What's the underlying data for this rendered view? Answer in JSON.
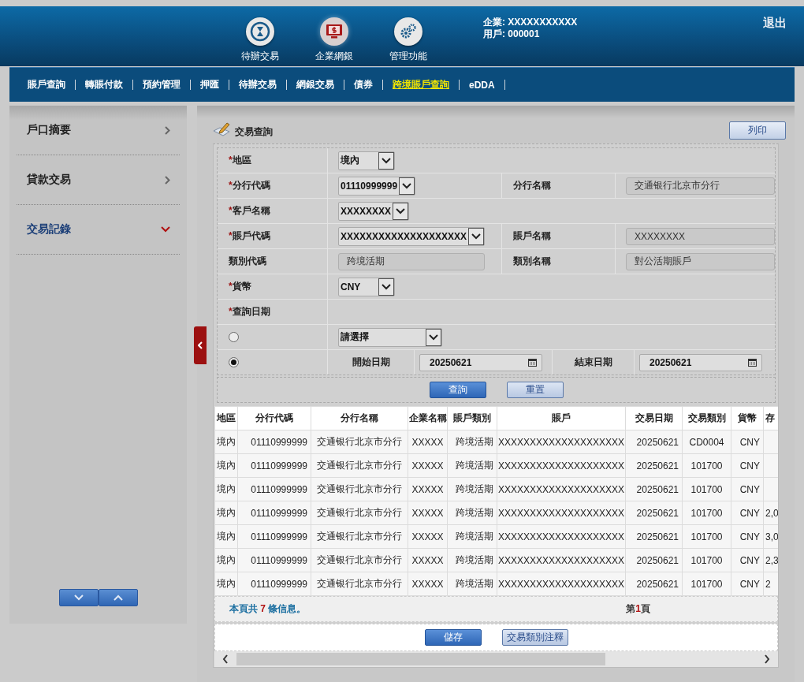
{
  "header": {
    "modules": [
      {
        "label": "待辦交易",
        "selected": false
      },
      {
        "label": "企業網銀",
        "selected": true
      },
      {
        "label": "管理功能",
        "selected": false
      }
    ],
    "company": "企業: XXXXXXXXXXX",
    "user": "用戶: 000001",
    "logout": "退出"
  },
  "nav": [
    {
      "label": "賬戶查詢",
      "selected": false
    },
    {
      "label": "轉賬付款",
      "selected": false
    },
    {
      "label": "預約管理",
      "selected": false
    },
    {
      "label": "押匯",
      "selected": false
    },
    {
      "label": "待辦交易",
      "selected": false
    },
    {
      "label": "網銀交易",
      "selected": false
    },
    {
      "label": "債券",
      "selected": false
    },
    {
      "label": "跨境賬戶查詢",
      "selected": true
    },
    {
      "label": "eDDA",
      "selected": false
    }
  ],
  "sidebar": {
    "items": [
      {
        "label": "戶口摘要",
        "expanded": false
      },
      {
        "label": "貸款交易",
        "expanded": false
      },
      {
        "label": "交易記錄",
        "expanded": true
      }
    ]
  },
  "page": {
    "title": "交易查詢",
    "print_button": "列印"
  },
  "form": {
    "rows": [
      {
        "kind": "field",
        "label": "地區",
        "required_mark": "*",
        "control": {
          "kind": "select",
          "value": "境內"
        }
      },
      {
        "kind": "field",
        "label": "分行代碼",
        "required_mark": "*",
        "control": {
          "kind": "select",
          "value": "01110999999"
        },
        "right": {
          "label": "分行名稱",
          "control": {
            "kind": "readonly",
            "value": "交通银行北京市分行"
          }
        }
      },
      {
        "kind": "field",
        "label": "客戶名稱",
        "required_mark": "*",
        "control": {
          "kind": "select",
          "value": "XXXXXXXX"
        }
      },
      {
        "kind": "field",
        "label": "賬戶代碼",
        "required_mark": "*",
        "control": {
          "kind": "select",
          "value": "XXXXXXXXXXXXXXXXXXXX"
        },
        "right": {
          "label": "賬戶名稱",
          "control": {
            "kind": "readonly",
            "value": "XXXXXXXX"
          }
        }
      },
      {
        "kind": "field",
        "label": "類別代碼",
        "control": {
          "kind": "readonly",
          "value": "跨境活期"
        },
        "right": {
          "label": "類別名稱",
          "control": {
            "kind": "readonly",
            "value": "對公活期賬戶"
          }
        }
      },
      {
        "kind": "field",
        "label": "貨幣",
        "required_mark": "*",
        "control": {
          "kind": "select",
          "value": "CNY"
        }
      },
      {
        "kind": "field",
        "label": "查詢日期",
        "required_mark": "*"
      },
      {
        "kind": "radio-select",
        "selected": false,
        "value": "請選擇"
      },
      {
        "kind": "radio-range",
        "selected": true,
        "start_label": "開始日期",
        "start": "20250621",
        "end_label": "結束日期",
        "end": "20250621"
      }
    ],
    "buttons": [
      {
        "label": "查詢",
        "primary": true
      },
      {
        "label": "重置",
        "primary": false
      }
    ]
  },
  "table": {
    "columns": [
      "地區",
      "分行代碼",
      "分行名稱",
      "企業名稱",
      "賬戶類別",
      "賬戶",
      "交易日期",
      "交易類別",
      "貨幣",
      "存"
    ],
    "rows": [
      {
        "cells": [
          "境內",
          "01110999999",
          "交通银行北京市分行",
          "XXXXX",
          "跨境活期",
          "XXXXXXXXXXXXXXXXXXXX",
          "20250621",
          "CD0004",
          "CNY"
        ]
      },
      {
        "cells": [
          "境內",
          "01110999999",
          "交通银行北京市分行",
          "XXXXX",
          "跨境活期",
          "XXXXXXXXXXXXXXXXXXXX",
          "20250621",
          "101700",
          "CNY"
        ]
      },
      {
        "cells": [
          "境內",
          "01110999999",
          "交通银行北京市分行",
          "XXXXX",
          "跨境活期",
          "XXXXXXXXXXXXXXXXXXXX",
          "20250621",
          "101700",
          "CNY"
        ]
      },
      {
        "cells": [
          "境內",
          "01110999999",
          "交通银行北京市分行",
          "XXXXX",
          "跨境活期",
          "XXXXXXXXXXXXXXXXXXXX",
          "20250621",
          "101700",
          "CNY",
          "2,0"
        ]
      },
      {
        "cells": [
          "境內",
          "01110999999",
          "交通银行北京市分行",
          "XXXXX",
          "跨境活期",
          "XXXXXXXXXXXXXXXXXXXX",
          "20250621",
          "101700",
          "CNY",
          "3,0"
        ]
      },
      {
        "cells": [
          "境內",
          "01110999999",
          "交通银行北京市分行",
          "XXXXX",
          "跨境活期",
          "XXXXXXXXXXXXXXXXXXXX",
          "20250621",
          "101700",
          "CNY",
          "2,3"
        ]
      },
      {
        "cells": [
          "境內",
          "01110999999",
          "交通银行北京市分行",
          "XXXXX",
          "跨境活期",
          "XXXXXXXXXXXXXXXXXXXX",
          "20250621",
          "101700",
          "CNY",
          "2"
        ]
      }
    ],
    "footer": {
      "count_prefix": "本頁共",
      "count": "7",
      "count_suffix": "條信息。",
      "page_prefix": "第",
      "page": "1",
      "page_suffix": "頁"
    }
  },
  "bottom_buttons": [
    {
      "label": "儲存",
      "primary": true
    },
    {
      "label": "交易類別注釋",
      "primary": false
    }
  ]
}
